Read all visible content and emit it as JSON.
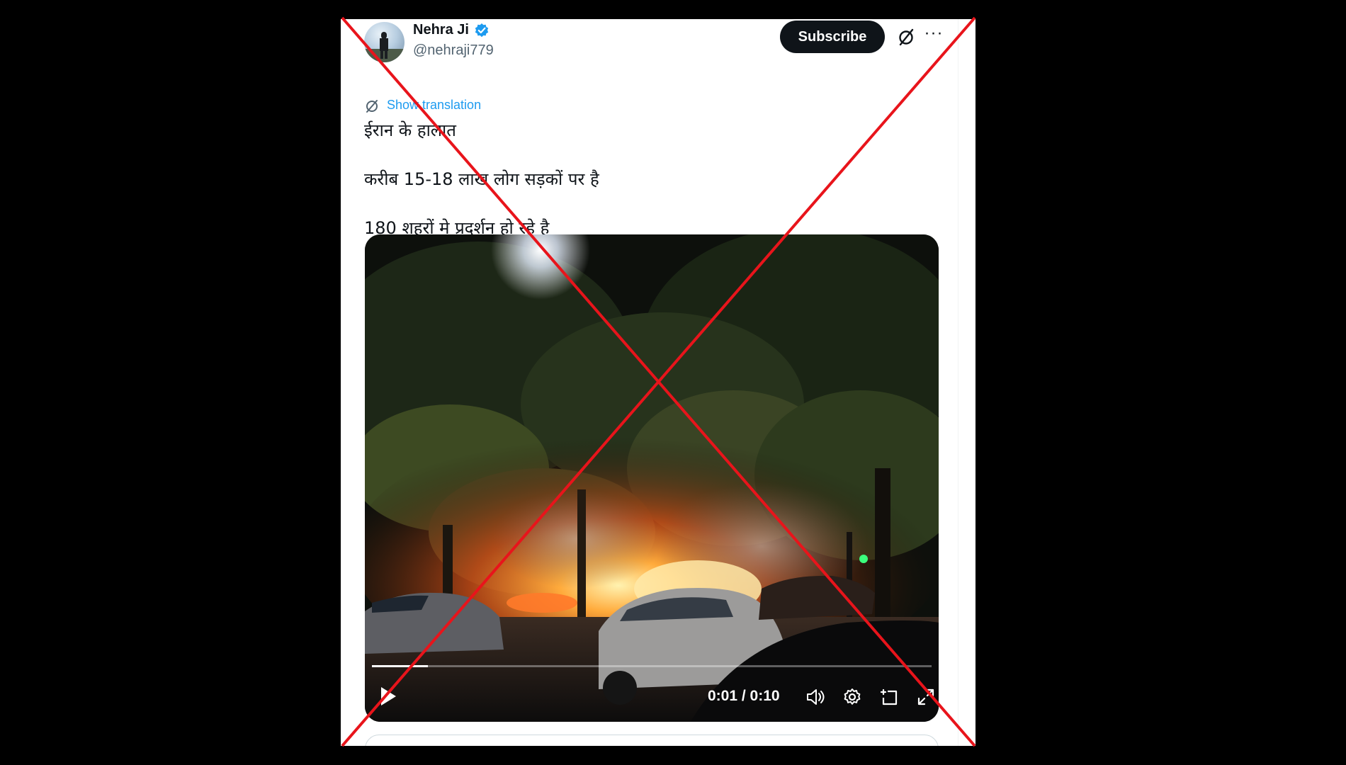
{
  "tweet": {
    "author": {
      "display_name": "Nehra Ji",
      "handle": "@nehraji779",
      "verified": true,
      "verified_badge_color": "#1d9bf0"
    },
    "subscribe_label": "Subscribe",
    "translate_label": "Show translation",
    "text_lines": [
      "ईरान के हालात",
      "करीब 15-18 लाख लोग सड़कों पर है",
      "180 शहरों मे प्रदर्शन हो रहे है"
    ],
    "video": {
      "time_readout": "0:01 / 0:10",
      "progress_fraction": 0.1
    },
    "icons": [
      "grok-icon",
      "more-icon",
      "translate-icon",
      "play-icon",
      "volume-icon",
      "settings-icon",
      "pip-icon",
      "fullscreen-icon"
    ]
  },
  "overlay": {
    "cross_color": "#e8141b"
  }
}
